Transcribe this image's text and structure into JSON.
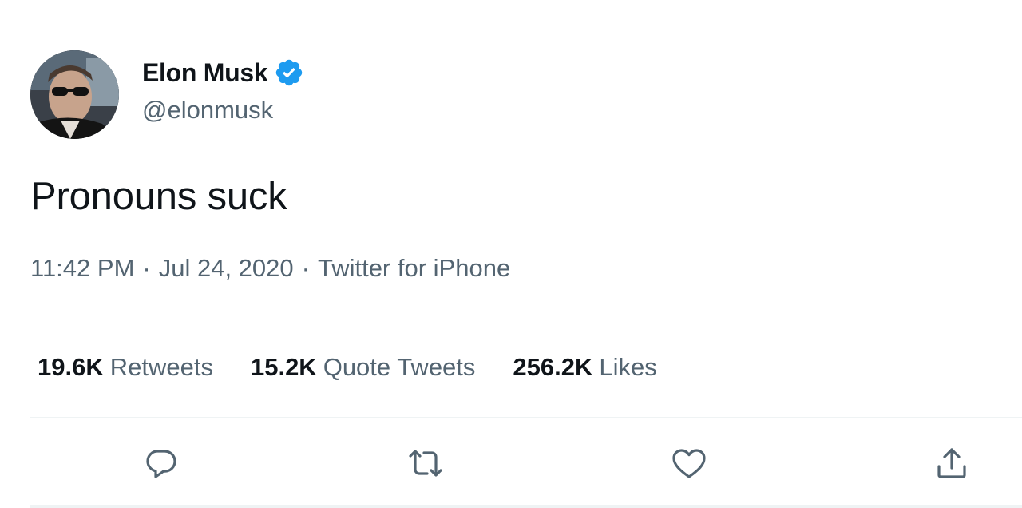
{
  "author": {
    "display_name": "Elon Musk",
    "handle": "@elonmusk",
    "verified": true
  },
  "tweet": {
    "text": "Pronouns suck",
    "time": "11:42 PM",
    "date": "Jul 24, 2020",
    "source": "Twitter for iPhone",
    "separator": "·"
  },
  "stats": [
    {
      "count": "19.6K",
      "label": "Retweets"
    },
    {
      "count": "15.2K",
      "label": "Quote Tweets"
    },
    {
      "count": "256.2K",
      "label": "Likes"
    }
  ],
  "actions": {
    "reply_icon": "reply-icon",
    "retweet_icon": "retweet-icon",
    "like_icon": "heart-icon",
    "share_icon": "share-icon"
  },
  "colors": {
    "text_primary": "#0f1419",
    "text_secondary": "#536471",
    "verified_blue": "#1d9bf0",
    "divider": "#eff3f4"
  }
}
